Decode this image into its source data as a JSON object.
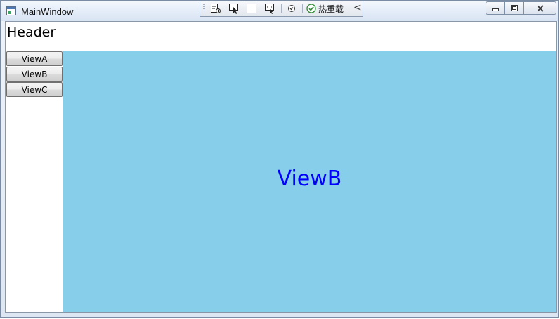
{
  "window": {
    "title": "MainWindow",
    "icon": "app-window-icon"
  },
  "debug_toolbar": {
    "tools": [
      "select-element-icon",
      "pointer-select-icon",
      "layout-adorner-icon",
      "track-focus-icon",
      "binding-failures-icon"
    ],
    "hot_reload_label": "热重载",
    "hot_reload_status_icon": "checkmark-circle-icon",
    "collapse_glyph": "<"
  },
  "caption_buttons": [
    "minimize",
    "maximize",
    "close"
  ],
  "header": {
    "text": "Header"
  },
  "nav": {
    "buttons": [
      {
        "label": "ViewA"
      },
      {
        "label": "ViewB"
      },
      {
        "label": "ViewC"
      }
    ]
  },
  "content": {
    "label": "ViewB",
    "background": "#87CEEB",
    "text_color": "#0000FF"
  }
}
